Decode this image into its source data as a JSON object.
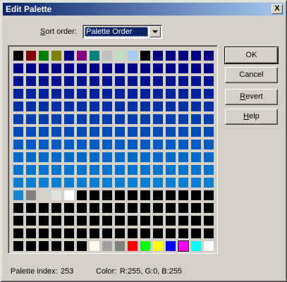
{
  "window": {
    "title": "Edit Palette",
    "close_symbol": "X"
  },
  "sort": {
    "label": "Sort order:",
    "selected": "Palette Order"
  },
  "buttons": {
    "ok": "OK",
    "cancel": "Cancel",
    "revert": "Revert",
    "help": "Help"
  },
  "status": {
    "index_label": "Palette index:",
    "index_value": "253",
    "color_label": "Color:",
    "color_value": "R:255, G:0, B:255"
  },
  "palette": {
    "columns": 16,
    "selected_index": 253,
    "colors": [
      "#000000",
      "#800000",
      "#008000",
      "#808000",
      "#000080",
      "#800080",
      "#008080",
      "#c0c0c0",
      "#c0dcc0",
      "#a6caf0",
      "#000000",
      "#000080",
      "#000080",
      "#000080",
      "#000080",
      "#000080",
      "#00008b",
      "#00008b",
      "#00008b",
      "#00008b",
      "#00008b",
      "#00008b",
      "#00008b",
      "#00008b",
      "#00008b",
      "#00008b",
      "#00008b",
      "#00008b",
      "#00008b",
      "#00008b",
      "#00008b",
      "#00008b",
      "#001490",
      "#001490",
      "#001490",
      "#001490",
      "#001490",
      "#001490",
      "#001490",
      "#001490",
      "#001490",
      "#001490",
      "#001490",
      "#001490",
      "#001490",
      "#001490",
      "#001490",
      "#001490",
      "#00229a",
      "#00229a",
      "#00229a",
      "#00229a",
      "#00229a",
      "#00229a",
      "#00229a",
      "#00229a",
      "#00229a",
      "#00229a",
      "#00229a",
      "#00229a",
      "#00229a",
      "#00229a",
      "#00229a",
      "#00229a",
      "#0031a4",
      "#0031a4",
      "#0031a4",
      "#0031a4",
      "#0031a4",
      "#0031a4",
      "#0031a4",
      "#0031a4",
      "#0031a4",
      "#0031a4",
      "#0031a4",
      "#0031a4",
      "#0031a4",
      "#0031a4",
      "#0031a4",
      "#0031a4",
      "#003fae",
      "#003fae",
      "#003fae",
      "#003fae",
      "#003fae",
      "#003fae",
      "#003fae",
      "#003fae",
      "#003fae",
      "#003fae",
      "#003fae",
      "#003fae",
      "#003fae",
      "#003fae",
      "#003fae",
      "#003fae",
      "#004db8",
      "#004db8",
      "#004db8",
      "#004db8",
      "#004db8",
      "#004db8",
      "#004db8",
      "#004db8",
      "#004db8",
      "#004db8",
      "#004db8",
      "#004db8",
      "#004db8",
      "#004db8",
      "#004db8",
      "#004db8",
      "#005cc0",
      "#005cc0",
      "#005cc0",
      "#005cc0",
      "#005cc0",
      "#005cc0",
      "#005cc0",
      "#005cc0",
      "#005cc0",
      "#005cc0",
      "#005cc0",
      "#005cc0",
      "#005cc0",
      "#005cc0",
      "#005cc0",
      "#005cc0",
      "#006ac8",
      "#006ac8",
      "#006ac8",
      "#006ac8",
      "#006ac8",
      "#006ac8",
      "#006ac8",
      "#006ac8",
      "#006ac8",
      "#006ac8",
      "#006ac8",
      "#006ac8",
      "#006ac8",
      "#006ac8",
      "#006ac8",
      "#006ac8",
      "#0074cc",
      "#0074cc",
      "#0074cc",
      "#0074cc",
      "#0074cc",
      "#0074cc",
      "#0074cc",
      "#0074cc",
      "#0074cc",
      "#0074cc",
      "#0074cc",
      "#0074cc",
      "#0074cc",
      "#0074cc",
      "#0074cc",
      "#0074cc",
      "#0a7ed0",
      "#0a7ed0",
      "#0a7ed0",
      "#0a7ed0",
      "#0a7ed0",
      "#0a7ed0",
      "#0a7ed0",
      "#0a7ed0",
      "#0a7ed0",
      "#0a7ed0",
      "#0a7ed0",
      "#0a7ed0",
      "#0a7ed0",
      "#0a7ed0",
      "#0a7ed0",
      "#0a7ed0",
      "#1584d4",
      "#808080",
      "#d4d0c8",
      "#e0e0e0",
      "#ffffff",
      "#000000",
      "#000000",
      "#000000",
      "#000000",
      "#000000",
      "#000000",
      "#000000",
      "#000000",
      "#000000",
      "#000000",
      "#000000",
      "#000000",
      "#000000",
      "#000000",
      "#000000",
      "#000000",
      "#000000",
      "#000000",
      "#000000",
      "#000000",
      "#000000",
      "#000000",
      "#000000",
      "#000000",
      "#000000",
      "#000000",
      "#000000",
      "#000000",
      "#000000",
      "#000000",
      "#000000",
      "#000000",
      "#000000",
      "#000000",
      "#000000",
      "#000000",
      "#000000",
      "#000000",
      "#000000",
      "#000000",
      "#000000",
      "#000000",
      "#000000",
      "#000000",
      "#000000",
      "#000000",
      "#000000",
      "#000000",
      "#000000",
      "#000000",
      "#000000",
      "#000000",
      "#000000",
      "#000000",
      "#000000",
      "#000000",
      "#000000",
      "#000000",
      "#000000",
      "#000000",
      "#000000",
      "#000000",
      "#000000",
      "#000000",
      "#000000",
      "#fffbf0",
      "#a0a0a4",
      "#808080",
      "#ff0000",
      "#00ff00",
      "#ffff00",
      "#0000ff",
      "#ff00ff",
      "#00ffff",
      "#ffffff"
    ]
  }
}
